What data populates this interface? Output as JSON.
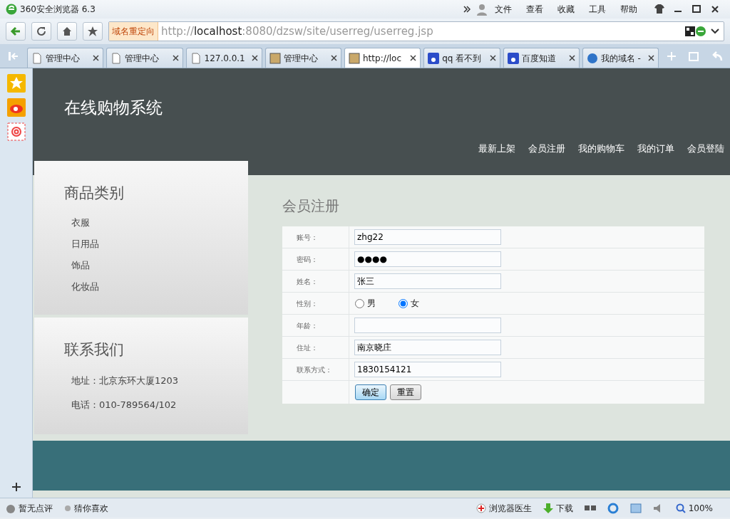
{
  "browser": {
    "title": "360安全浏览器 6.3",
    "menu": [
      "文件",
      "查看",
      "收藏",
      "工具",
      "帮助"
    ],
    "address": {
      "badge": "域名重定向",
      "scheme": "http://",
      "host": "localhost",
      "path": ":8080/dzsw/site/userreg/userreg.jsp"
    },
    "tabs": [
      {
        "label": "管理中心",
        "kind": "page",
        "selected": false
      },
      {
        "label": "管理中心",
        "kind": "page",
        "selected": false
      },
      {
        "label": "127.0.0.1",
        "kind": "page",
        "selected": false
      },
      {
        "label": "管理中心",
        "kind": "image",
        "selected": false
      },
      {
        "label": "http://loc",
        "kind": "image",
        "selected": true
      },
      {
        "label": "qq 看不到",
        "kind": "paw",
        "selected": false
      },
      {
        "label": "百度知道",
        "kind": "paw",
        "selected": false
      },
      {
        "label": "我的域名 -",
        "kind": "globe",
        "selected": false
      }
    ]
  },
  "page": {
    "site_title": "在线购物系统",
    "nav": [
      "最新上架",
      "会员注册",
      "我的购物车",
      "我的订单",
      "会员登陆"
    ],
    "categories": {
      "title": "商品类别",
      "items": [
        "衣服",
        "日用品",
        "饰品",
        "化妆品"
      ]
    },
    "contact": {
      "title": "联系我们",
      "lines": [
        "地址：北京东环大厦1203",
        "电话：010-789564/102"
      ]
    },
    "form": {
      "title": "会员注册",
      "fields": [
        {
          "label": "账号：",
          "kind": "text",
          "value": "zhg22"
        },
        {
          "label": "密码：",
          "kind": "password",
          "value": "●●●●"
        },
        {
          "label": "姓名：",
          "kind": "text",
          "value": "张三"
        },
        {
          "label": "性别：",
          "kind": "radio",
          "options": [
            {
              "label": "男",
              "selected": false
            },
            {
              "label": "女",
              "selected": true
            }
          ]
        },
        {
          "label": "年龄：",
          "kind": "text"
        },
        {
          "label": "住址：",
          "kind": "text",
          "value": "南京晓庄"
        },
        {
          "label": "联系方式：",
          "kind": "text",
          "value": "1830154121"
        }
      ],
      "buttons": [
        {
          "label": "确定",
          "kind": "primary"
        },
        {
          "label": "重置",
          "kind": "plain"
        }
      ]
    }
  },
  "status_bar": {
    "left": [
      "暂无点评",
      "猜你喜欢"
    ],
    "doctor": "浏览器医生",
    "download": "下载",
    "zoom": "100%"
  }
}
